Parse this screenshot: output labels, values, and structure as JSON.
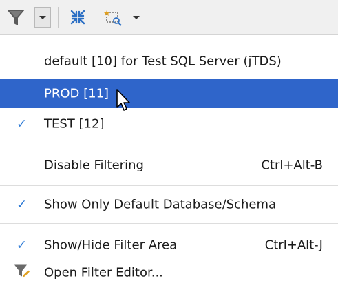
{
  "toolbar": {
    "icons": [
      "filter-icon",
      "dropdown-arrow-icon",
      "collapse-all-icon",
      "new-filter-icon",
      "dropdown-arrow-icon"
    ]
  },
  "menu": {
    "items": [
      {
        "label": "default [10] for Test SQL Server (jTDS)",
        "checked": false,
        "selected": false
      },
      {
        "label": "PROD [11]",
        "checked": false,
        "selected": true
      },
      {
        "label": "TEST [12]",
        "checked": true,
        "selected": false
      },
      {
        "label": "Disable Filtering",
        "shortcut": "Ctrl+Alt-B",
        "checked": false
      },
      {
        "label": "Show Only Default Database/Schema",
        "checked": true
      },
      {
        "label": "Show/Hide Filter Area",
        "shortcut": "Ctrl+Alt-J",
        "checked": true
      },
      {
        "label": "Open Filter Editor...",
        "icon": "filter-edit-icon"
      }
    ],
    "check_glyph": "✓"
  },
  "colors": {
    "selection": "#2f65ca",
    "check": "#2d7ad6",
    "toolbar_bg": "#f0f0f0"
  }
}
